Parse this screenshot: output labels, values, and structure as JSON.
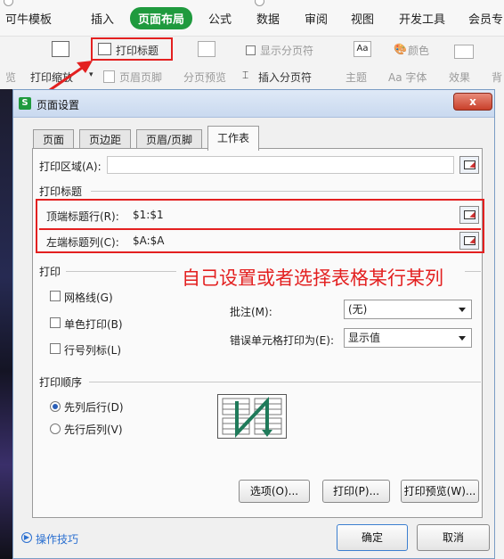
{
  "menubar": {
    "items": [
      "可牛模板",
      "插入",
      "页面布局",
      "公式",
      "数据",
      "审阅",
      "视图",
      "开发工具",
      "会员专"
    ],
    "active_index": 2
  },
  "toolbar": {
    "print_title": "打印标题",
    "print_scale": "打印缩放",
    "header_footer": "页眉页脚",
    "page_break_preview": "分页预览",
    "show_page_break": "显示分页符",
    "insert_page_break": "插入分页符",
    "theme": "主题",
    "color": "颜色",
    "font": "Aa 字体",
    "effect": "效果",
    "back": "背",
    "left_cut": "览",
    "theme_icon_text": "Aa"
  },
  "dialog": {
    "title": "页面设置",
    "app_icon_letter": "S",
    "close_glyph": "x",
    "tabs": [
      "页面",
      "页边距",
      "页眉/页脚",
      "工作表"
    ],
    "active_tab": 3,
    "print_area_label": "打印区域(A):",
    "print_area_value": "",
    "print_titles_group": "打印标题",
    "top_rows_label": "顶端标题行(R):",
    "top_rows_value": "$1:$1",
    "left_cols_label": "左端标题列(C):",
    "left_cols_value": "$A:$A",
    "print_group": "打印",
    "gridlines": "网格线(G)",
    "black_white": "单色打印(B)",
    "row_col_headers": "行号列标(L)",
    "comments_label": "批注(M):",
    "comments_value": "(无)",
    "errors_label": "错误单元格打印为(E):",
    "errors_value": "显示值",
    "order_group": "打印顺序",
    "down_then_over": "先列后行(D)",
    "over_then_down": "先行后列(V)",
    "options_button": "选项(O)...",
    "print_button": "打印(P)...",
    "preview_button": "打印预览(W)...",
    "ok_button": "确定",
    "cancel_button": "取消",
    "tips_label": "操作技巧"
  },
  "annotation": {
    "text": "自己设置或者选择表格某行某列",
    "color": "#e32020"
  },
  "colors": {
    "accent_green": "#1f9a3e",
    "highlight_red": "#e32020",
    "link_blue": "#2a6fd0"
  }
}
